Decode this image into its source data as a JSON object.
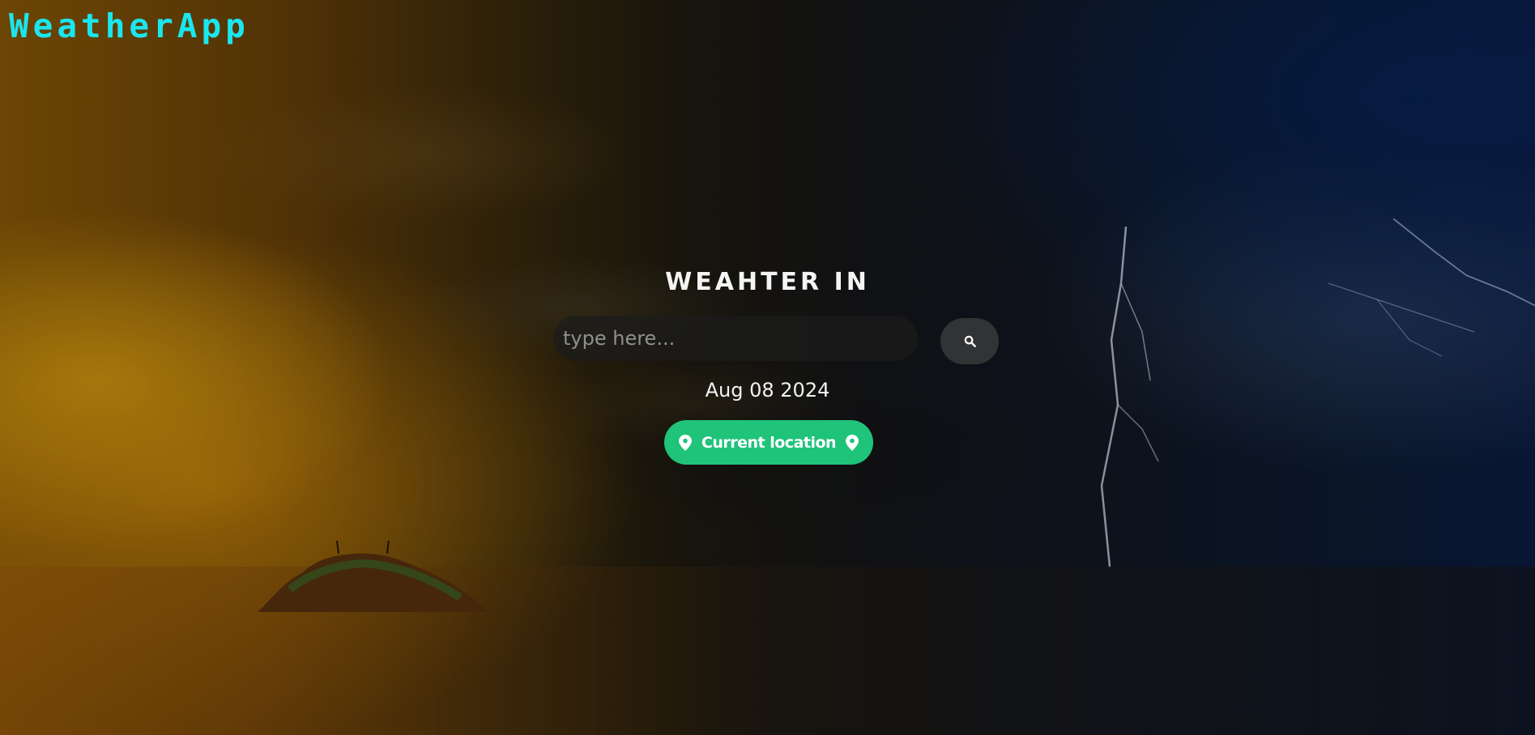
{
  "app": {
    "brand": "WeatherApp"
  },
  "search": {
    "heading": "WEAHTER IN",
    "placeholder": "type here...",
    "value": "",
    "button_icon": "search-icon"
  },
  "date": "Aug 08 2024",
  "location_button": {
    "label": "Current location",
    "icon_left": "map-pin-icon",
    "icon_right": "map-pin-icon"
  },
  "colors": {
    "brand": "#1ae6ee",
    "accent": "#1fc37a",
    "text": "#f4f4f4"
  }
}
